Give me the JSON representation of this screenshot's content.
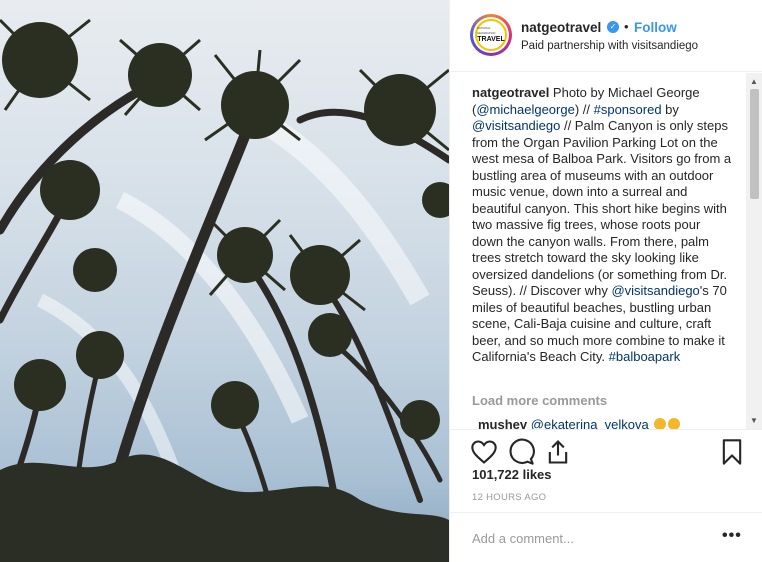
{
  "post": {
    "username": "natgeotravel",
    "verified": true,
    "follow_label": "Follow",
    "separator": "•",
    "partnership": "Paid partnership with visitsandiego",
    "avatar_lines": [
      "NATIONAL GEOGRAPHIC",
      "TRAVEL"
    ],
    "caption": {
      "author": "natgeotravel",
      "seg1": " Photo by Michael George (",
      "link1": "@michaelgeorge",
      "seg2": ") // ",
      "link2": "#sponsored",
      "seg3": " by ",
      "link3": "@visitsandiego",
      "seg4": " // Palm Canyon is only steps from the Organ Pavilion Parking Lot on the west mesa of Balboa Park. Visitors go from a bustling area of museums with an outdoor music venue, down into a surreal and beautiful canyon. This short hike begins with two massive fig trees, whose roots pour down the canyon walls. From there, palm trees stretch toward the sky looking like oversized dandelions (or something from Dr. Seuss). // Discover why ",
      "link4": "@visitsandiego",
      "seg5": "'s 70 miles of beautiful beaches, bustling urban scene, Cali-Baja cuisine and culture, craft beer, and so much more combine to make it California's Beach City. ",
      "link5": "#balboapark"
    },
    "load_more": "Load more comments",
    "comment": {
      "user": "mushev",
      "mention": "@ekaterina_velkova"
    },
    "likes": "101,722 likes",
    "time": "12 HOURS AGO",
    "add_comment_placeholder": "Add a comment...",
    "more_options": "•••"
  },
  "icons": [
    "heart-icon",
    "comment-icon",
    "share-icon",
    "bookmark-icon",
    "verified-icon"
  ],
  "colors": {
    "link": "#003569",
    "follow": "#3897f0",
    "muted": "#999999"
  }
}
